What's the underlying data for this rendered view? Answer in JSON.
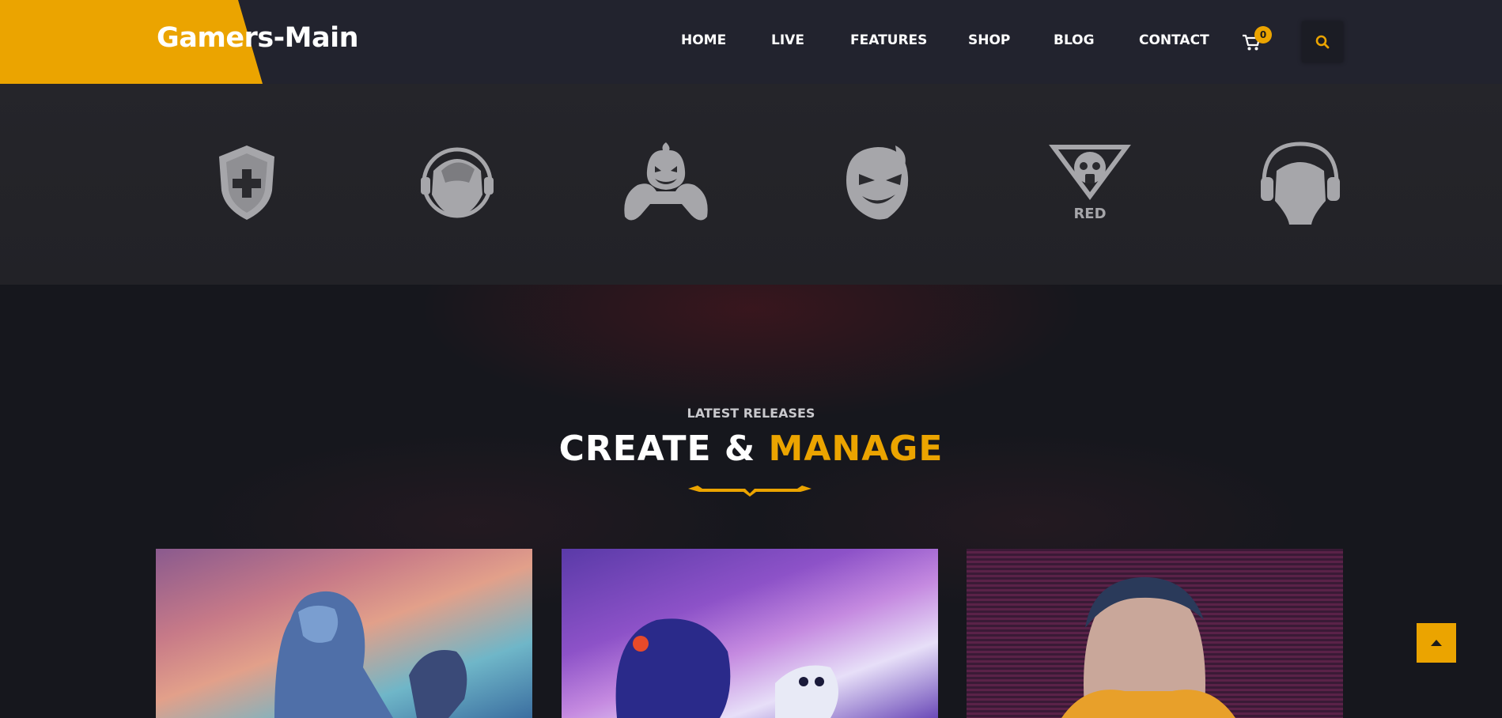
{
  "header": {
    "logo": "Gamers-Main",
    "nav": [
      {
        "label": "HOME"
      },
      {
        "label": "LIVE"
      },
      {
        "label": "FEATURES"
      },
      {
        "label": "SHOP"
      },
      {
        "label": "BLOG"
      },
      {
        "label": "CONTACT"
      }
    ],
    "cart_count": "0",
    "cart_icon": "cart-icon",
    "search_icon": "search-icon"
  },
  "sponsors": {
    "logos": [
      {
        "name": "shield-cross-logo"
      },
      {
        "name": "headphone-gamer-logo"
      },
      {
        "name": "pumpkin-controller-logo"
      },
      {
        "name": "devil-face-logo"
      },
      {
        "name": "gas-mask-red-logo",
        "text": "RED"
      },
      {
        "name": "headset-silhouette-logo"
      }
    ]
  },
  "section": {
    "kicker": "LATEST RELEASES",
    "title_main": "CREATE & ",
    "title_accent": "MANAGE"
  },
  "cards": [
    {
      "image": "frost-warrior-artwork"
    },
    {
      "image": "owl-spirit-artwork"
    },
    {
      "image": "cyberpunk-character-artwork"
    }
  ],
  "colors": {
    "accent": "#eba400",
    "header_bg": "#22232e",
    "page_bg": "#17181d"
  }
}
